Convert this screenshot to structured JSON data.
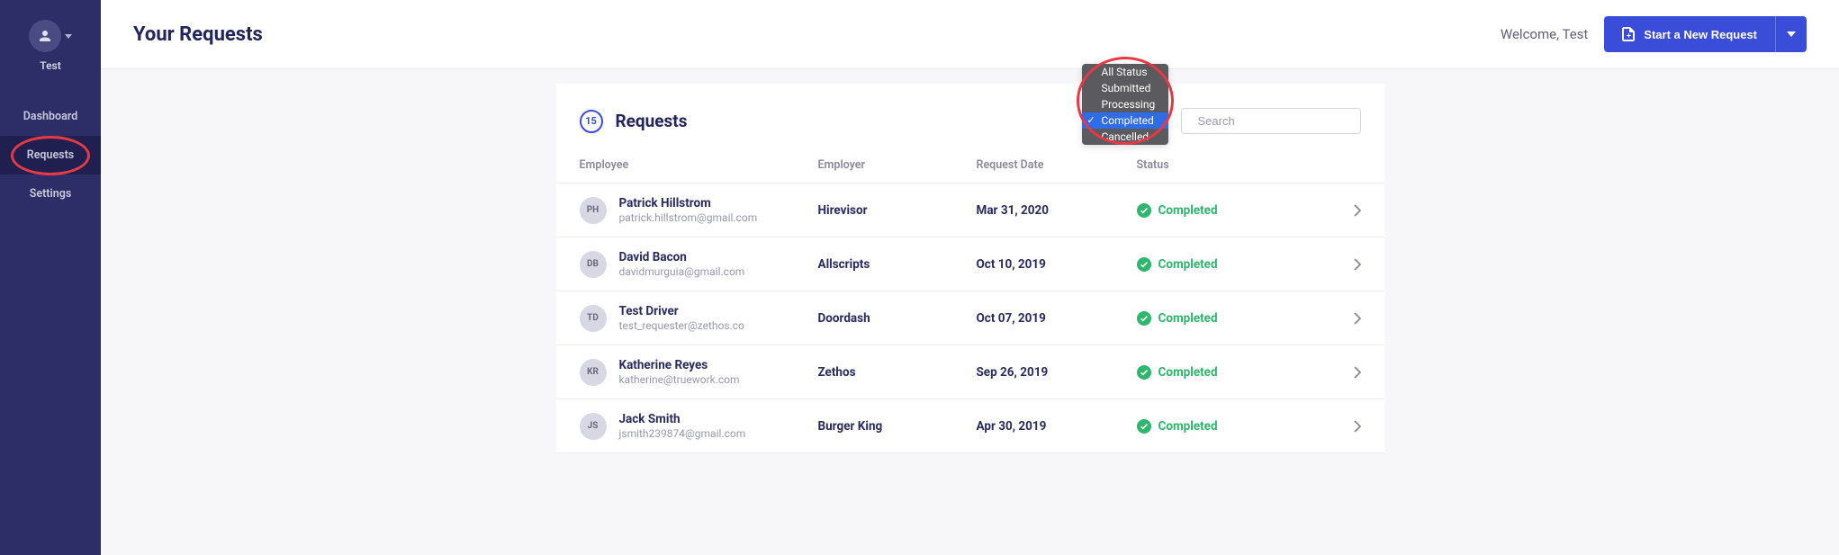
{
  "user": {
    "name": "Test"
  },
  "sidebar": {
    "items": [
      {
        "label": "Dashboard",
        "active": false
      },
      {
        "label": "Requests",
        "active": true
      },
      {
        "label": "Settings",
        "active": false
      }
    ]
  },
  "header": {
    "title": "Your Requests",
    "welcome": "Welcome, Test",
    "new_request_label": "Start a New Request"
  },
  "card": {
    "count": "15",
    "title": "Requests"
  },
  "filters": {
    "status_options": [
      "All Status",
      "Submitted",
      "Processing",
      "Completed",
      "Cancelled"
    ],
    "status_selected": "Completed",
    "search_placeholder": "Search"
  },
  "columns": {
    "employee": "Employee",
    "employer": "Employer",
    "date": "Request Date",
    "status": "Status"
  },
  "rows": [
    {
      "initials": "PH",
      "name": "Patrick Hillstrom",
      "email": "patrick.hillstrom@gmail.com",
      "employer": "Hirevisor",
      "date": "Mar 31, 2020",
      "status": "Completed"
    },
    {
      "initials": "DB",
      "name": "David Bacon",
      "email": "davidmurguia@gmail.com",
      "employer": "Allscripts",
      "date": "Oct 10, 2019",
      "status": "Completed"
    },
    {
      "initials": "TD",
      "name": "Test Driver",
      "email": "test_requester@zethos.co",
      "employer": "Doordash",
      "date": "Oct 07, 2019",
      "status": "Completed"
    },
    {
      "initials": "KR",
      "name": "Katherine Reyes",
      "email": "katherine@truework.com",
      "employer": "Zethos",
      "date": "Sep 26, 2019",
      "status": "Completed"
    },
    {
      "initials": "JS",
      "name": "Jack Smith",
      "email": "jsmith239874@gmail.com",
      "employer": "Burger King",
      "date": "Apr 30, 2019",
      "status": "Completed"
    }
  ],
  "colors": {
    "sidebar_bg": "#2d2e68",
    "accent": "#3a4dd8",
    "success": "#2fb66c",
    "highlight_ring": "#e63946"
  }
}
